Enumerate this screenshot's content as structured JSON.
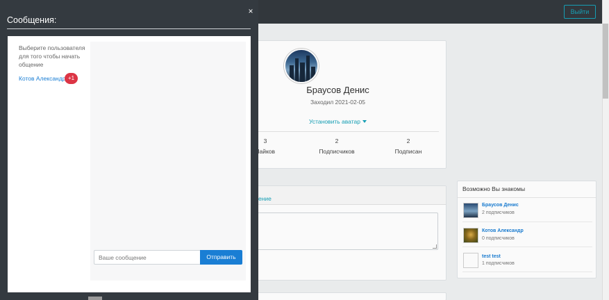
{
  "navbar": {
    "logout_label": "Выйти"
  },
  "profile": {
    "name": "Браусов Денис",
    "last_seen": "Заходил 2021-02-05",
    "set_avatar_label": "Установить аватар",
    "stats": [
      {
        "value": "3",
        "label": "Лайков"
      },
      {
        "value": "2",
        "label": "Подписчиков"
      },
      {
        "value": "2",
        "label": "Подписан"
      }
    ]
  },
  "post": {
    "tab_label": "ение"
  },
  "suggestions": {
    "title": "Возможно Вы знакомы",
    "items": [
      {
        "name": "Браусов Денис",
        "subtitle": "2 подписчиков"
      },
      {
        "name": "Котов Александр",
        "subtitle": "0 подписчиков"
      },
      {
        "name": "test test",
        "subtitle": "1 подписчиков"
      }
    ]
  },
  "messages": {
    "title": "Сообщения:",
    "close_label": "×",
    "hint": "Выберите пользователя для того чтобы начать общение",
    "contacts": [
      {
        "name": "Котов Александр",
        "badge": "+1"
      }
    ],
    "input_placeholder": "Ваше сообщение",
    "send_label": "Отправить"
  },
  "colors": {
    "accent": "#17a2b8",
    "link": "#1a7ed4",
    "panel": "#343a40",
    "badge": "#dc3545"
  }
}
